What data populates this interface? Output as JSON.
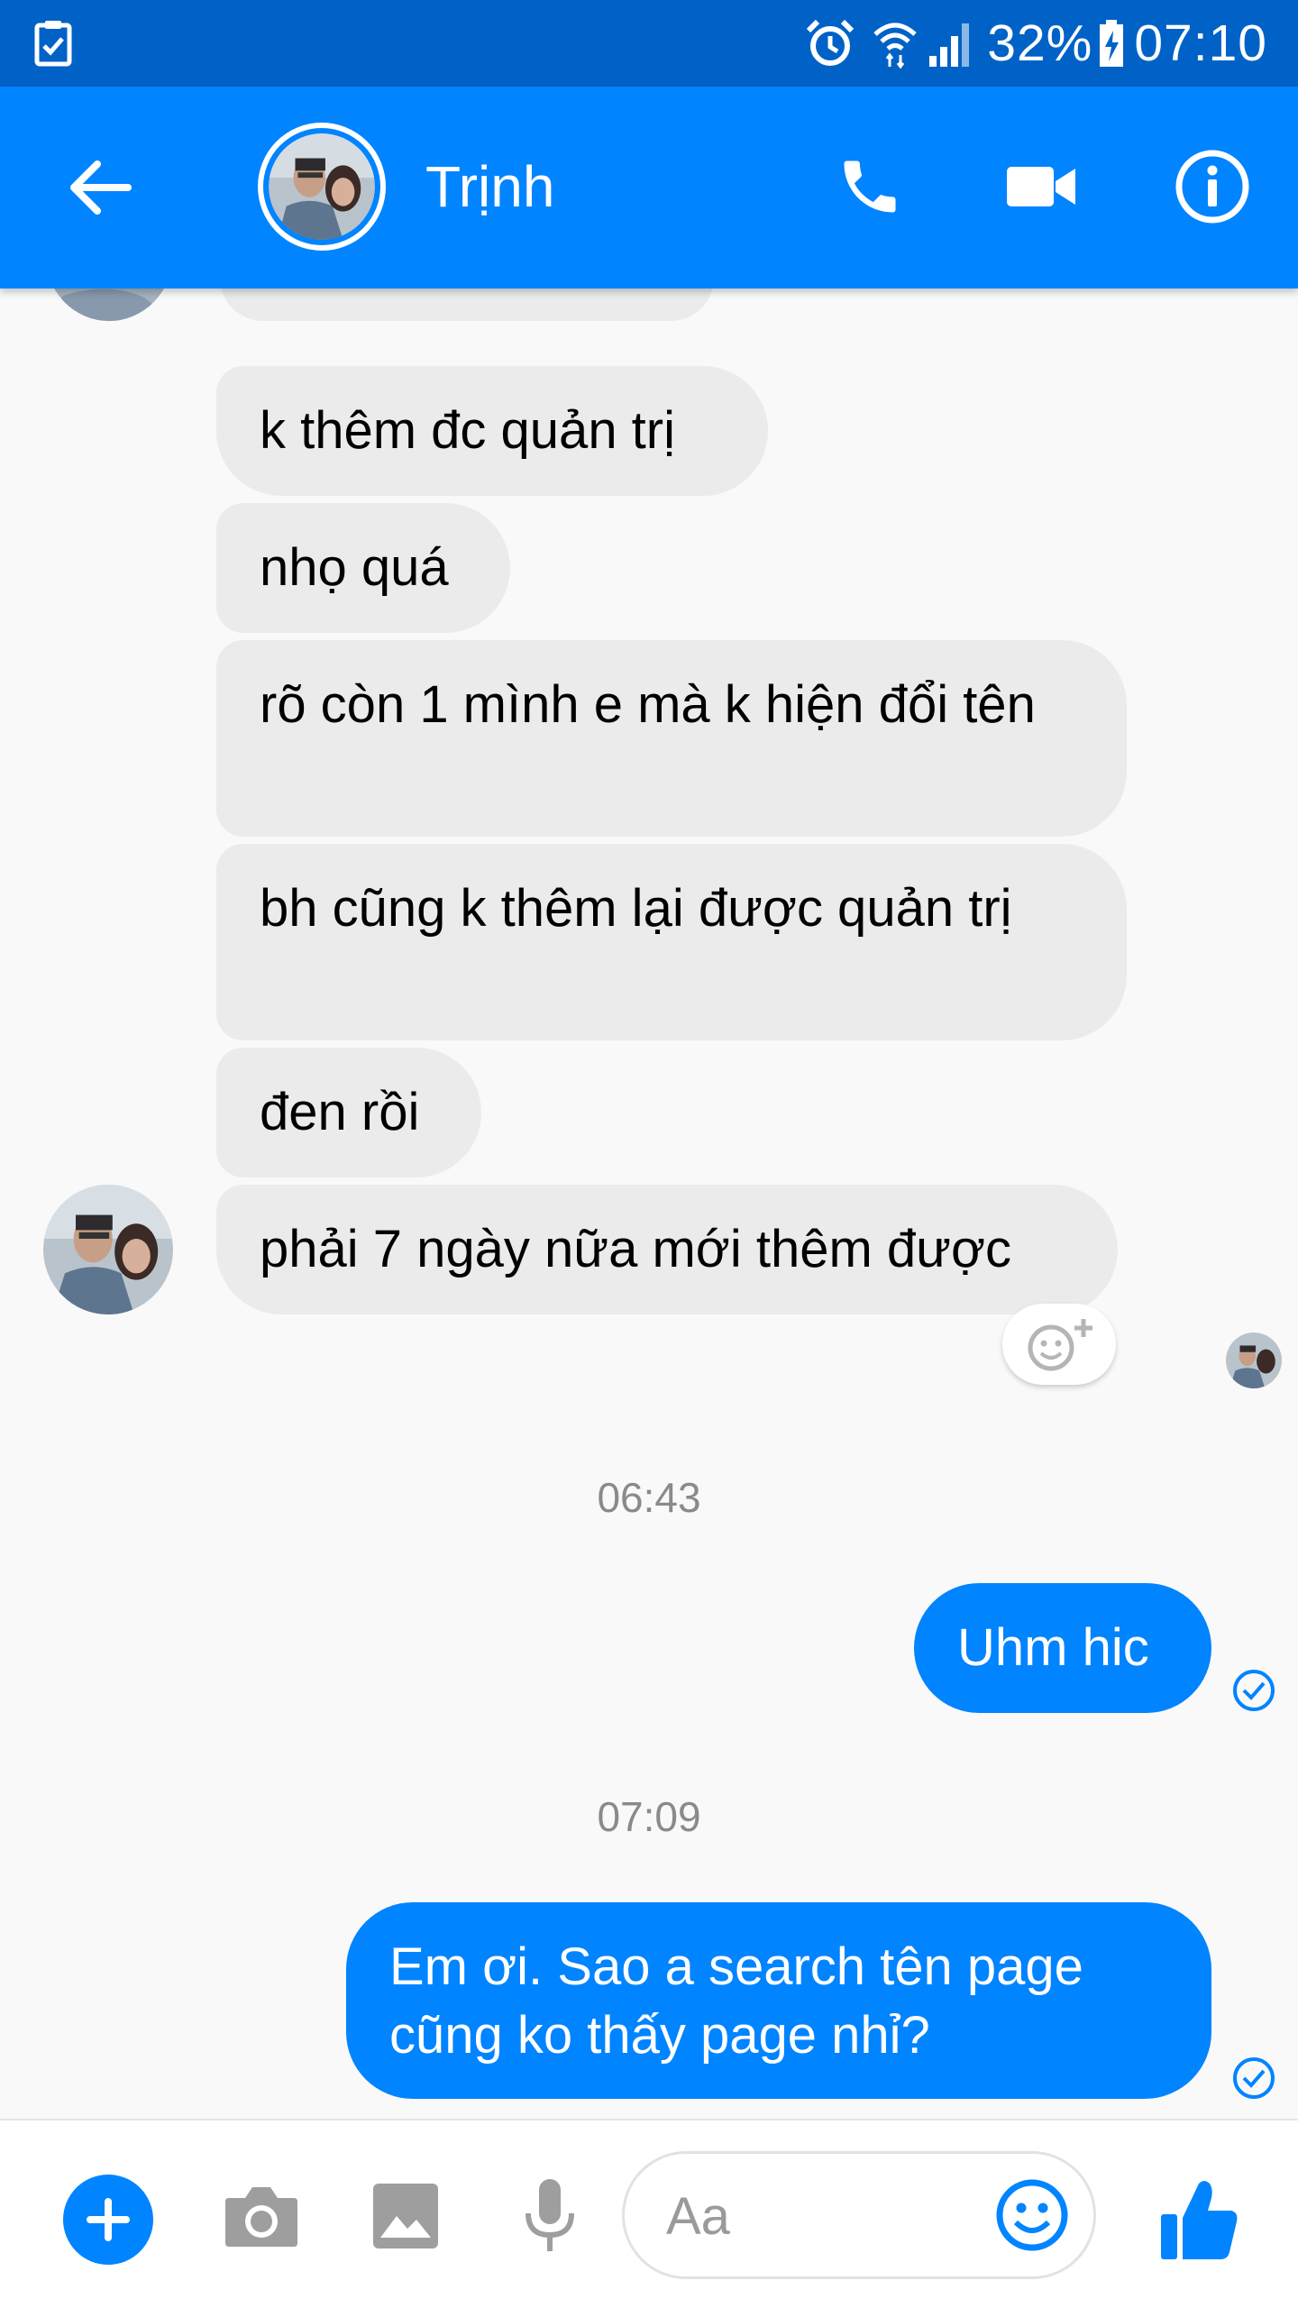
{
  "status_bar": {
    "battery": "32%",
    "time": "07:10",
    "icons": [
      "checklist-icon",
      "alarm-icon",
      "wifi-icon",
      "signal-icon",
      "battery-charging-icon"
    ]
  },
  "header": {
    "contact_name": "Trịnh",
    "icons": [
      "back-arrow-icon",
      "phone-icon",
      "video-camera-icon",
      "info-icon"
    ]
  },
  "messages": [
    {
      "sender": "contact",
      "text": "k thêm đc quản trị"
    },
    {
      "sender": "contact",
      "text": "nhọ quá"
    },
    {
      "sender": "contact",
      "text": "rõ còn 1 mình e mà k hiện đổi tên"
    },
    {
      "sender": "contact",
      "text": "bh cũng k thêm lại được quản trị"
    },
    {
      "sender": "contact",
      "text": "đen rồi"
    },
    {
      "sender": "contact",
      "text": "phải 7 ngày nữa mới thêm được"
    },
    {
      "type": "timestamp",
      "text": "06:43"
    },
    {
      "sender": "me",
      "text": "Uhm hic"
    },
    {
      "type": "timestamp",
      "text": "07:09"
    },
    {
      "sender": "me",
      "text": "Em ơi. Sao a search tên page cũng ko thấy page nhỉ?"
    }
  ],
  "composer": {
    "placeholder": "Aa",
    "icons": [
      "plus-icon",
      "camera-icon",
      "image-icon",
      "microphone-icon",
      "emoji-icon",
      "thumbs-up-icon"
    ]
  },
  "colors": {
    "status_bar": "#0062c7",
    "header": "#0084ff",
    "outgoing_bubble": "#0084ff",
    "incoming_bubble": "#ebebeb",
    "background": "#f9f9f9"
  }
}
